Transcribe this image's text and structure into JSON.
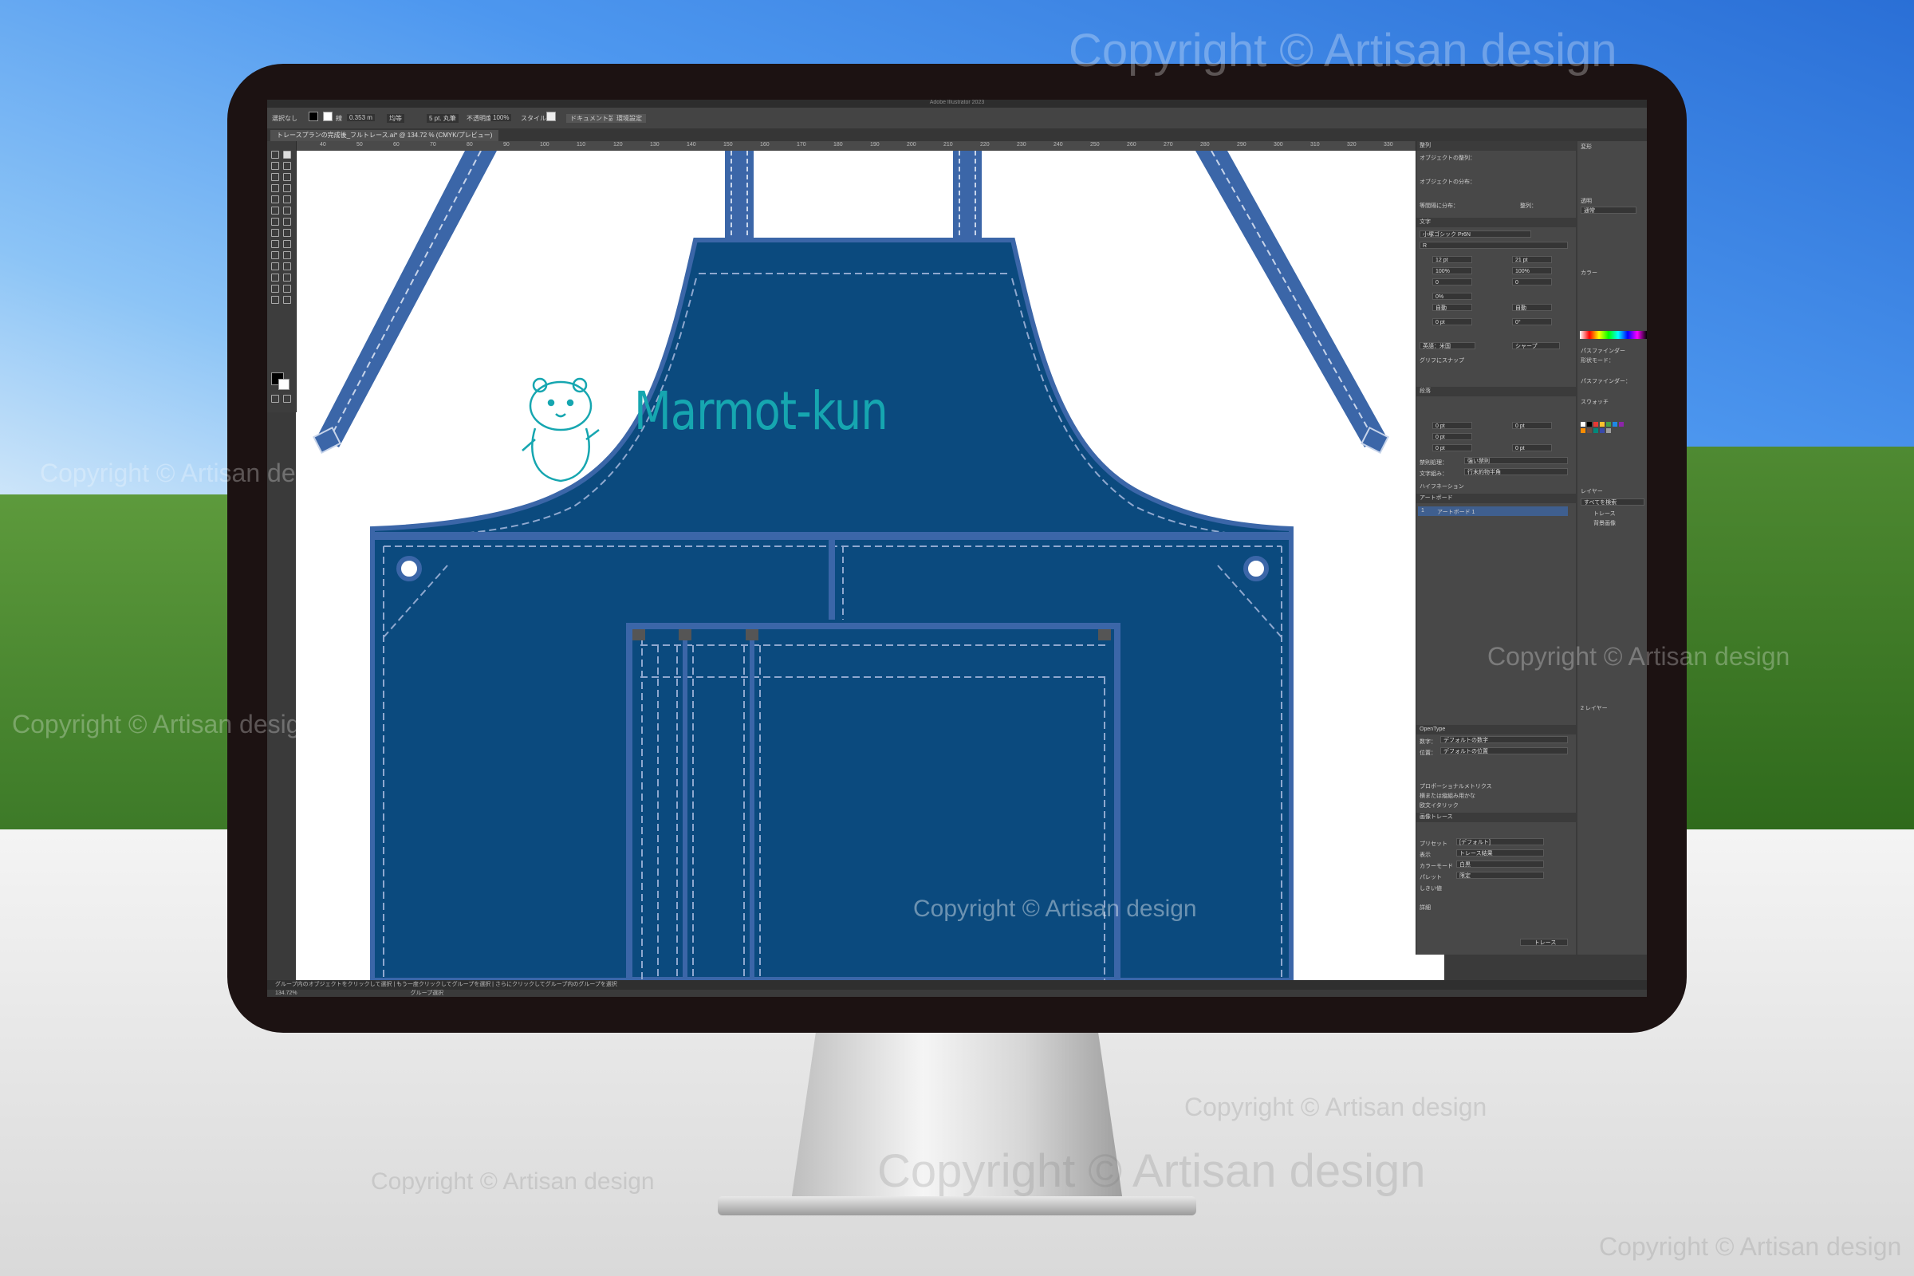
{
  "app": {
    "window_title": "Adobe Illustrator 2023",
    "document_tab": "トレースプランの完成後_フルトレース.ai* @ 134.72 % (CMYK/プレビュー)"
  },
  "control_bar": {
    "selection": "選択なし",
    "stroke_label": "線",
    "stroke_weight": "0.353 m",
    "stroke_profile": "均等",
    "brush": "5 pt. 丸筆",
    "opacity_label": "不透明度",
    "opacity_value": "100%",
    "style_label": "スタイル",
    "doc_setup_button": "ドキュメント設定",
    "preferences_button": "環境設定"
  },
  "ruler": {
    "ticks": [
      "40",
      "50",
      "60",
      "70",
      "80",
      "90",
      "100",
      "110",
      "120",
      "130",
      "140",
      "150",
      "160",
      "170",
      "180",
      "190",
      "200",
      "210",
      "220",
      "230",
      "240",
      "250",
      "260",
      "270",
      "280",
      "290",
      "300",
      "310",
      "320",
      "330"
    ]
  },
  "artwork": {
    "logo_text": "Marmot-kun",
    "apron_color": "#0b4a7e",
    "strap_color": "#3b66a8",
    "logo_color": "#16a6b0"
  },
  "panels": {
    "align": {
      "title": "整列",
      "align_objects": "オブジェクトの整列：",
      "distribute_objects": "オブジェクトの分布：",
      "distribute_spacing": "等間隔に分布：",
      "align_to": "整列："
    },
    "character": {
      "title": "文字",
      "font_family": "小塚ゴシック Pr6N",
      "font_style": "R",
      "font_size": "12 pt",
      "leading": "21 pt",
      "horizontal_scale": "100%",
      "vertical_scale": "100%",
      "kerning": "0",
      "tracking": "0",
      "tsume": "0%",
      "auto1": "自動",
      "auto2": "自動",
      "baseline": "0 pt",
      "rotation": "0°",
      "language": "英語：米国",
      "antialias": "シャープ",
      "glyph_snap": "グリフにスナップ"
    },
    "paragraph": {
      "title": "段落",
      "indent_left": "0 pt",
      "indent_right": "0 pt",
      "first_line": "0 pt",
      "space_before": "0 pt",
      "space_after": "0 pt",
      "kinsoku": "禁則処理：",
      "kinsoku_value": "強い禁則",
      "mojikumi": "文字組み：",
      "mojikumi_value": "行末約物半角",
      "hyphenation": "ハイフネーション"
    },
    "artboards": {
      "title": "アートボード",
      "index": "1",
      "name": "アートボード 1"
    },
    "opentype": {
      "title": "OpenType",
      "figure_label": "数字：",
      "figure_value": "デフォルトの数字",
      "position_label": "位置：",
      "position_value": "デフォルトの位置",
      "option1": "プロポーショナルメトリクス",
      "option2": "横または縦組み用かな",
      "option3": "欧文イタリック"
    },
    "image_trace": {
      "title": "画像トレース",
      "preset_label": "プリセット",
      "preset_value": "[デフォルト]",
      "view_label": "表示",
      "view_value": "トレース結果",
      "mode_label": "カラーモード",
      "mode_value": "白黒",
      "palette_label": "パレット",
      "palette_value": "限定",
      "threshold_label": "しきい値",
      "advanced": "詳細",
      "trace_button": "トレース"
    },
    "right": {
      "transform": "変形",
      "appearance": "透明",
      "blend_mode": "通常",
      "color": "カラー",
      "pathfinder": "パスファインダー",
      "shape_modes": "形状モード：",
      "pathfinders": "パスファインダー：",
      "swatches": "スウォッチ",
      "layers": "レイヤー",
      "search_all": "すべてを検索",
      "layer1": "トレース",
      "layer2": "背景画像",
      "layers_count": "2 レイヤー"
    }
  },
  "status": {
    "hint": "グループ内のオブジェクトをクリックして選択 | もう一度クリックしてグループを選択 | さらにクリックしてグループ内のグループを選択",
    "zoom": "134.72%",
    "mode": "グループ選択"
  },
  "watermark": {
    "text": "Copyright © Artisan design"
  }
}
